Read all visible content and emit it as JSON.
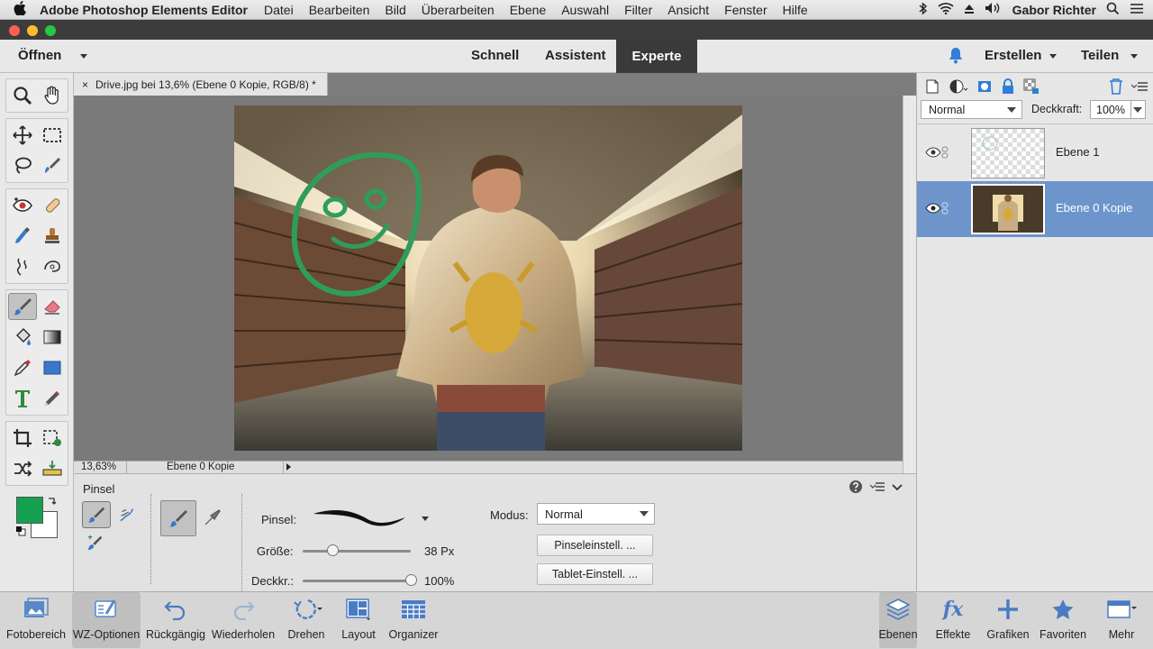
{
  "menubar": {
    "apple_icon": "apple-logo-icon",
    "app_name": "Adobe Photoshop Elements Editor",
    "items": [
      "Datei",
      "Bearbeiten",
      "Bild",
      "Überarbeiten",
      "Ebene",
      "Auswahl",
      "Filter",
      "Ansicht",
      "Fenster",
      "Hilfe"
    ],
    "user": "Gabor Richter"
  },
  "topbar": {
    "open_label": "Öffnen",
    "modes": [
      "Schnell",
      "Assistent",
      "Experte"
    ],
    "create_label": "Erstellen",
    "share_label": "Teilen"
  },
  "document": {
    "tab_title": "Drive.jpg bei 13,6% (Ebene 0 Kopie, RGB/8) *",
    "close_glyph": "×",
    "zoom": "13,63%",
    "layer_info": "Ebene 0 Kopie"
  },
  "tool_options": {
    "title": "Pinsel",
    "brush_label": "Pinsel:",
    "size_label": "Größe:",
    "size_value": "38 Px",
    "size_fraction": 0.28,
    "opacity_label": "Deckkr.:",
    "opacity_value": "100%",
    "opacity_fraction": 1.0,
    "mode_label": "Modus:",
    "mode_value": "Normal",
    "brush_settings_button": "Pinseleinstell. ...",
    "tablet_settings_button": "Tablet-Einstell. ..."
  },
  "layers_panel": {
    "blend_mode": "Normal",
    "opacity_label": "Deckkraft:",
    "opacity_value": "100%",
    "layers": [
      {
        "name": "Ebene 1",
        "selected": false
      },
      {
        "name": "Ebene 0 Kopie",
        "selected": true
      }
    ]
  },
  "bottombar": {
    "left": [
      "Fotobereich",
      "WZ-Optionen",
      "Rückgängig",
      "Wiederholen",
      "Drehen",
      "Layout",
      "Organizer"
    ],
    "right": [
      "Ebenen",
      "Effekte",
      "Grafiken",
      "Favoriten",
      "Mehr"
    ]
  },
  "colors": {
    "foreground": "#13a14f",
    "background": "#ffffff",
    "selected_layer": "#6d95cc",
    "accent_blue": "#2f7fd8"
  }
}
